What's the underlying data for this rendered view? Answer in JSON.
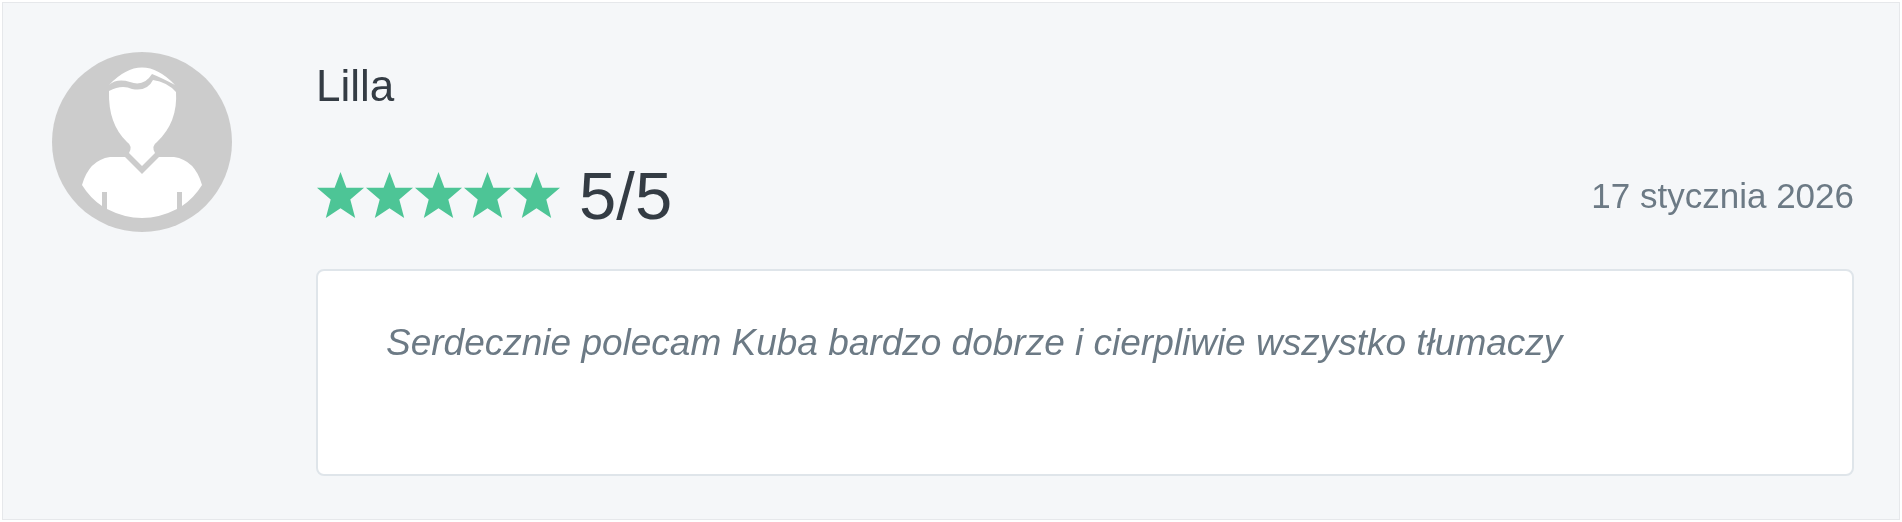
{
  "review": {
    "author": "Lilla",
    "stars": 5,
    "rating": "5/5",
    "date": "17 stycznia 2026",
    "text": "Serdecznie polecam Kuba bardzo dobrze i cierpliwie wszystko tłumaczy"
  }
}
